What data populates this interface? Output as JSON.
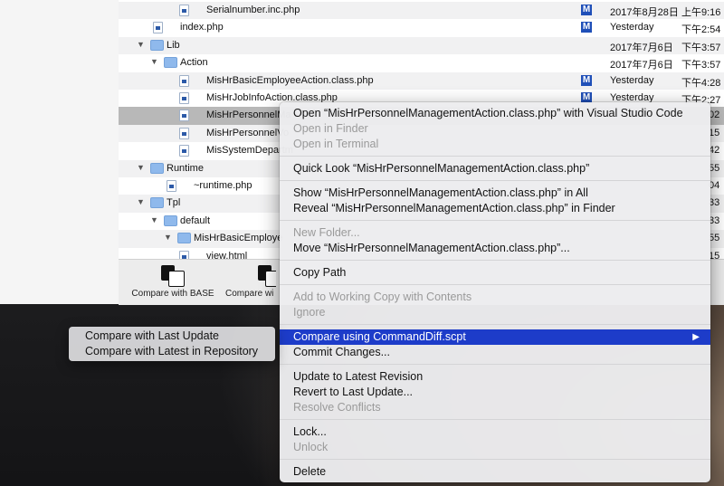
{
  "files": [
    {
      "indent": 3,
      "kind": "file",
      "name": "Serialnumber.inc.php",
      "badge": "M",
      "date": "2017年8月28日",
      "time": "上午9:16",
      "alt": true
    },
    {
      "indent": 1,
      "kind": "file",
      "name": "index.php",
      "badge": "M",
      "date": "Yesterday",
      "time": "下午2:54",
      "alt": false
    },
    {
      "indent": 0,
      "kind": "folder",
      "expanded": true,
      "name": "Lib",
      "badge": "",
      "date": "2017年7月6日",
      "time": "下午3:57",
      "alt": true
    },
    {
      "indent": 1,
      "kind": "folder",
      "expanded": true,
      "name": "Action",
      "badge": "",
      "date": "2017年7月6日",
      "time": "下午3:57",
      "alt": false
    },
    {
      "indent": 3,
      "kind": "file",
      "name": "MisHrBasicEmployeeAction.class.php",
      "badge": "M",
      "date": "Yesterday",
      "time": "下午4:28",
      "alt": true
    },
    {
      "indent": 3,
      "kind": "file",
      "name": "MisHrJobInfoAction.class.php",
      "badge": "M",
      "date": "Yesterday",
      "time": "下午2:27",
      "alt": false
    },
    {
      "indent": 3,
      "kind": "file",
      "name": "MisHrPersonnelMa",
      "badge": "",
      "date": "",
      "time": "02",
      "alt": false,
      "selected": true
    },
    {
      "indent": 3,
      "kind": "file",
      "name": "MisHrPersonnelVo",
      "badge": "",
      "date": "",
      "time": "15",
      "alt": true
    },
    {
      "indent": 3,
      "kind": "file",
      "name": "MisSystemDepartm",
      "badge": "",
      "date": "",
      "time": "42",
      "alt": false
    },
    {
      "indent": 0,
      "kind": "folder",
      "expanded": true,
      "name": "Runtime",
      "badge": "",
      "date": "",
      "time": "55",
      "alt": true
    },
    {
      "indent": 2,
      "kind": "file",
      "name": "~runtime.php",
      "badge": "",
      "date": "",
      "time": "04",
      "alt": false
    },
    {
      "indent": 0,
      "kind": "folder",
      "expanded": true,
      "name": "Tpl",
      "badge": "",
      "date": "",
      "time": "33",
      "alt": true
    },
    {
      "indent": 1,
      "kind": "folder",
      "expanded": true,
      "name": "default",
      "badge": "",
      "date": "",
      "time": "33",
      "alt": false
    },
    {
      "indent": 2,
      "kind": "folder",
      "expanded": true,
      "name": "MisHrBasicEmploye",
      "badge": "",
      "date": "",
      "time": "55",
      "alt": true
    },
    {
      "indent": 3,
      "kind": "file",
      "name": "view.html",
      "badge": "",
      "date": "",
      "time": "15",
      "alt": false
    }
  ],
  "toolbar": {
    "compare_base_label": "Compare with BASE",
    "compare_with_label": "Compare wi"
  },
  "menu": [
    {
      "type": "item",
      "label": "Open “MisHrPersonnelManagementAction.class.php” with Visual Studio Code",
      "disabled": false
    },
    {
      "type": "item",
      "label": "Open in Finder",
      "disabled": true
    },
    {
      "type": "item",
      "label": "Open in Terminal",
      "disabled": true
    },
    {
      "type": "sep"
    },
    {
      "type": "item",
      "label": "Quick Look “MisHrPersonnelManagementAction.class.php”",
      "disabled": false
    },
    {
      "type": "sep"
    },
    {
      "type": "item",
      "label": "Show “MisHrPersonnelManagementAction.class.php” in All",
      "disabled": false
    },
    {
      "type": "item",
      "label": "Reveal “MisHrPersonnelManagementAction.class.php” in Finder",
      "disabled": false
    },
    {
      "type": "sep"
    },
    {
      "type": "item",
      "label": "New Folder...",
      "disabled": true
    },
    {
      "type": "item",
      "label": "Move “MisHrPersonnelManagementAction.class.php”...",
      "disabled": false
    },
    {
      "type": "sep"
    },
    {
      "type": "item",
      "label": "Copy Path",
      "disabled": false
    },
    {
      "type": "sep"
    },
    {
      "type": "item",
      "label": "Add to Working Copy with Contents",
      "disabled": true
    },
    {
      "type": "item",
      "label": "Ignore",
      "disabled": true
    },
    {
      "type": "sep"
    },
    {
      "type": "item",
      "label": "Compare using CommandDiff.scpt",
      "disabled": false,
      "highlighted": true,
      "submenu": true
    },
    {
      "type": "item",
      "label": "Commit Changes...",
      "disabled": false
    },
    {
      "type": "sep"
    },
    {
      "type": "item",
      "label": "Update to Latest Revision",
      "disabled": false
    },
    {
      "type": "item",
      "label": "Revert to Last Update...",
      "disabled": false
    },
    {
      "type": "item",
      "label": "Resolve Conflicts",
      "disabled": true
    },
    {
      "type": "sep"
    },
    {
      "type": "item",
      "label": "Lock...",
      "disabled": false
    },
    {
      "type": "item",
      "label": "Unlock",
      "disabled": true
    },
    {
      "type": "sep"
    },
    {
      "type": "item",
      "label": "Delete",
      "disabled": false
    }
  ],
  "submenu": [
    {
      "label": "Compare with Last Update"
    },
    {
      "label": "Compare with Latest in Repository"
    }
  ],
  "colors": {
    "highlight": "#1d3cc9",
    "badge": "#1f4fb8",
    "folder": "#8fb9ec"
  }
}
